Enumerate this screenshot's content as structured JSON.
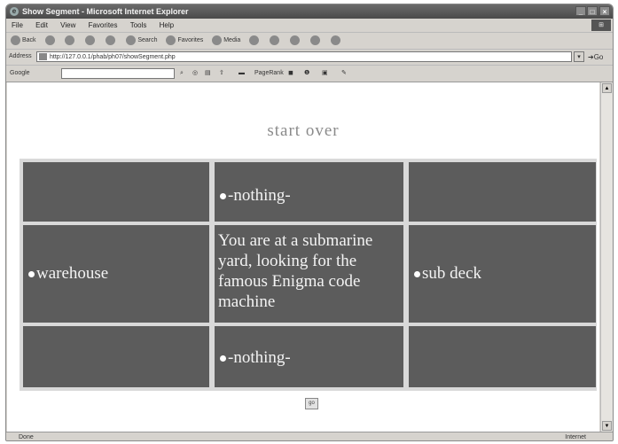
{
  "window": {
    "title": "Show Segment - Microsoft Internet Explorer"
  },
  "menu": {
    "items": [
      "File",
      "Edit",
      "View",
      "Favorites",
      "Tools",
      "Help"
    ]
  },
  "toolbar": {
    "back": "Back",
    "search": "Search",
    "favorites": "Favorites",
    "media": "Media"
  },
  "address": {
    "label": "Address",
    "url": "http://127.0.0.1/phab/ph07/showSegment.php",
    "go": "Go"
  },
  "googlebar": {
    "label": "Google",
    "pagerank": "PageRank"
  },
  "page": {
    "start_over": "start over",
    "cells": {
      "north": "-nothing-",
      "west": "warehouse",
      "center": "You are at a submarine yard, looking for the famous Enigma code machine",
      "east": "sub deck",
      "south": "-nothing-"
    },
    "submit_label": "go"
  },
  "status": {
    "left": "Done",
    "right": "Internet"
  },
  "colors": {
    "cell_bg": "#5c5c5c",
    "grid_line": "#d9d9d9",
    "link_text": "#8a8a8a"
  }
}
